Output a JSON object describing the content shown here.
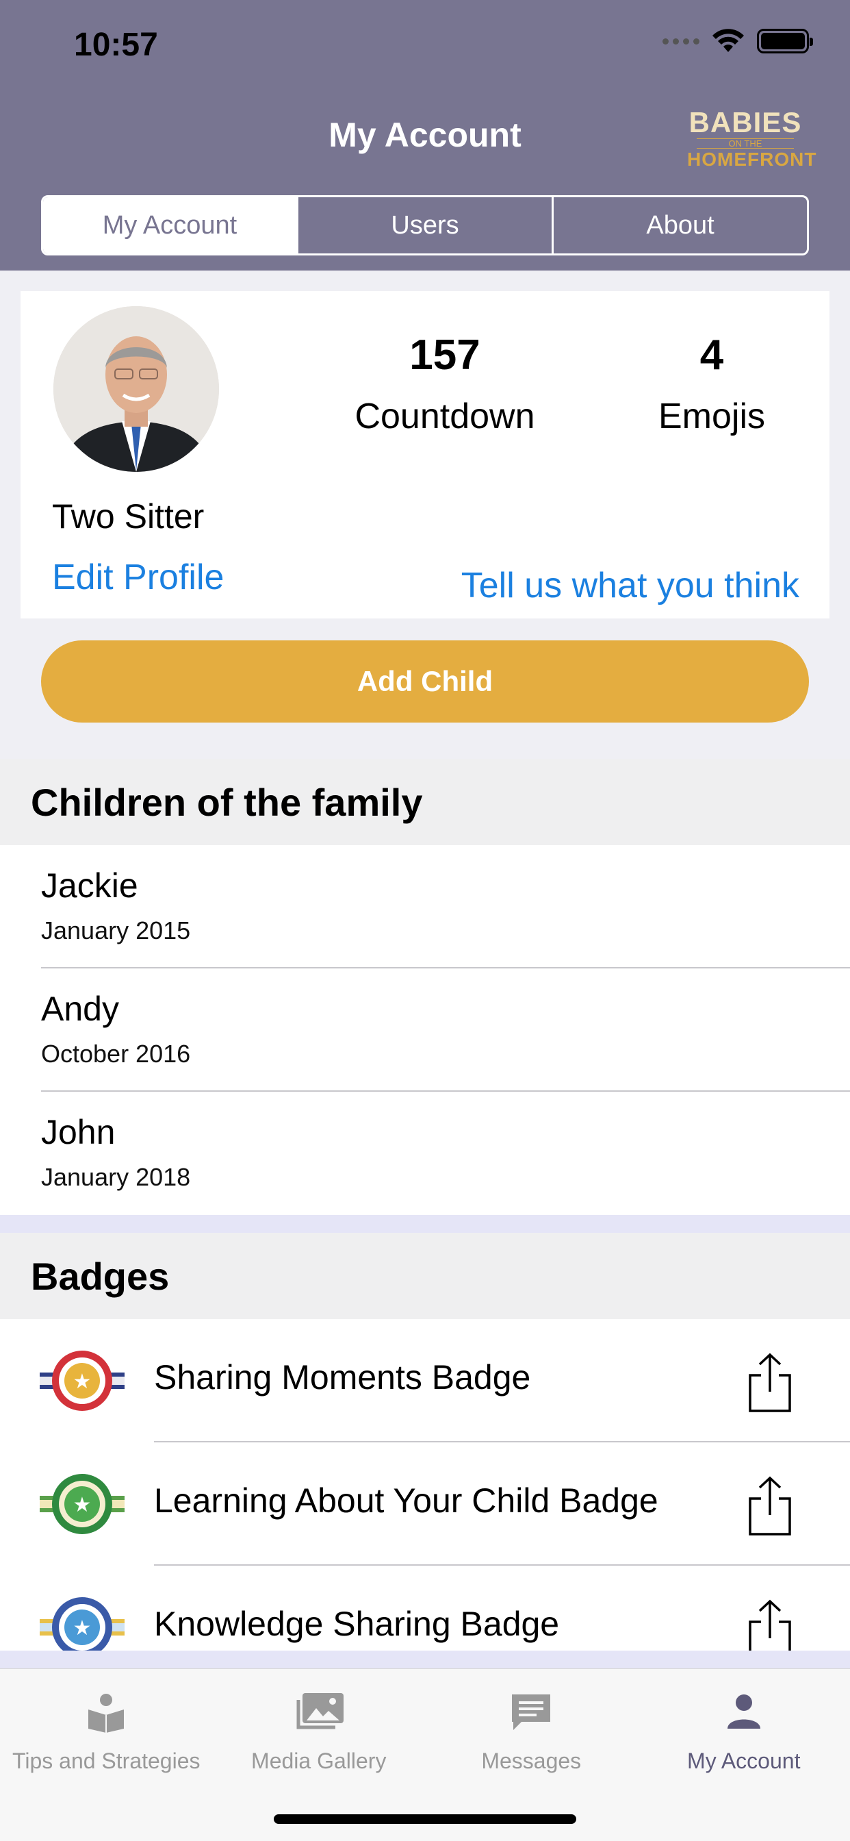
{
  "status_bar": {
    "time": "10:57"
  },
  "nav": {
    "title": "My Account",
    "logo": {
      "line1": "BABIES",
      "line2": "ON THE",
      "line3": "HOMEFRONT"
    }
  },
  "segments": [
    {
      "label": "My Account",
      "active": true
    },
    {
      "label": "Users",
      "active": false
    },
    {
      "label": "About",
      "active": false
    }
  ],
  "profile": {
    "name": "Two Sitter",
    "edit_link": "Edit Profile",
    "countdown_value": "157",
    "countdown_label": "Countdown",
    "emojis_value": "4",
    "emojis_label": "Emojis",
    "feedback_link": "Tell us what you think"
  },
  "add_child_label": "Add Child",
  "children_section": {
    "title": "Children of the family",
    "items": [
      {
        "name": "Jackie",
        "date": "January 2015"
      },
      {
        "name": "Andy",
        "date": "October 2016"
      },
      {
        "name": "John",
        "date": "January 2018"
      }
    ]
  },
  "badges_section": {
    "title": "Badges",
    "items": [
      {
        "name": "Sharing Moments Badge",
        "icon": "badge-red-icon"
      },
      {
        "name": "Learning About Your Child Badge",
        "icon": "badge-green-icon"
      },
      {
        "name": "Knowledge Sharing Badge",
        "icon": "badge-blue-icon"
      }
    ]
  },
  "tabbar": [
    {
      "label": "Tips and Strategies",
      "icon": "book-icon",
      "active": false
    },
    {
      "label": "Media Gallery",
      "icon": "photos-icon",
      "active": false
    },
    {
      "label": "Messages",
      "icon": "message-icon",
      "active": false
    },
    {
      "label": "My Account",
      "icon": "person-icon",
      "active": true
    }
  ],
  "colors": {
    "header": "#787591",
    "accent_button": "#e4ad40",
    "link": "#1b80e0",
    "tab_active": "#5d5a7a"
  }
}
